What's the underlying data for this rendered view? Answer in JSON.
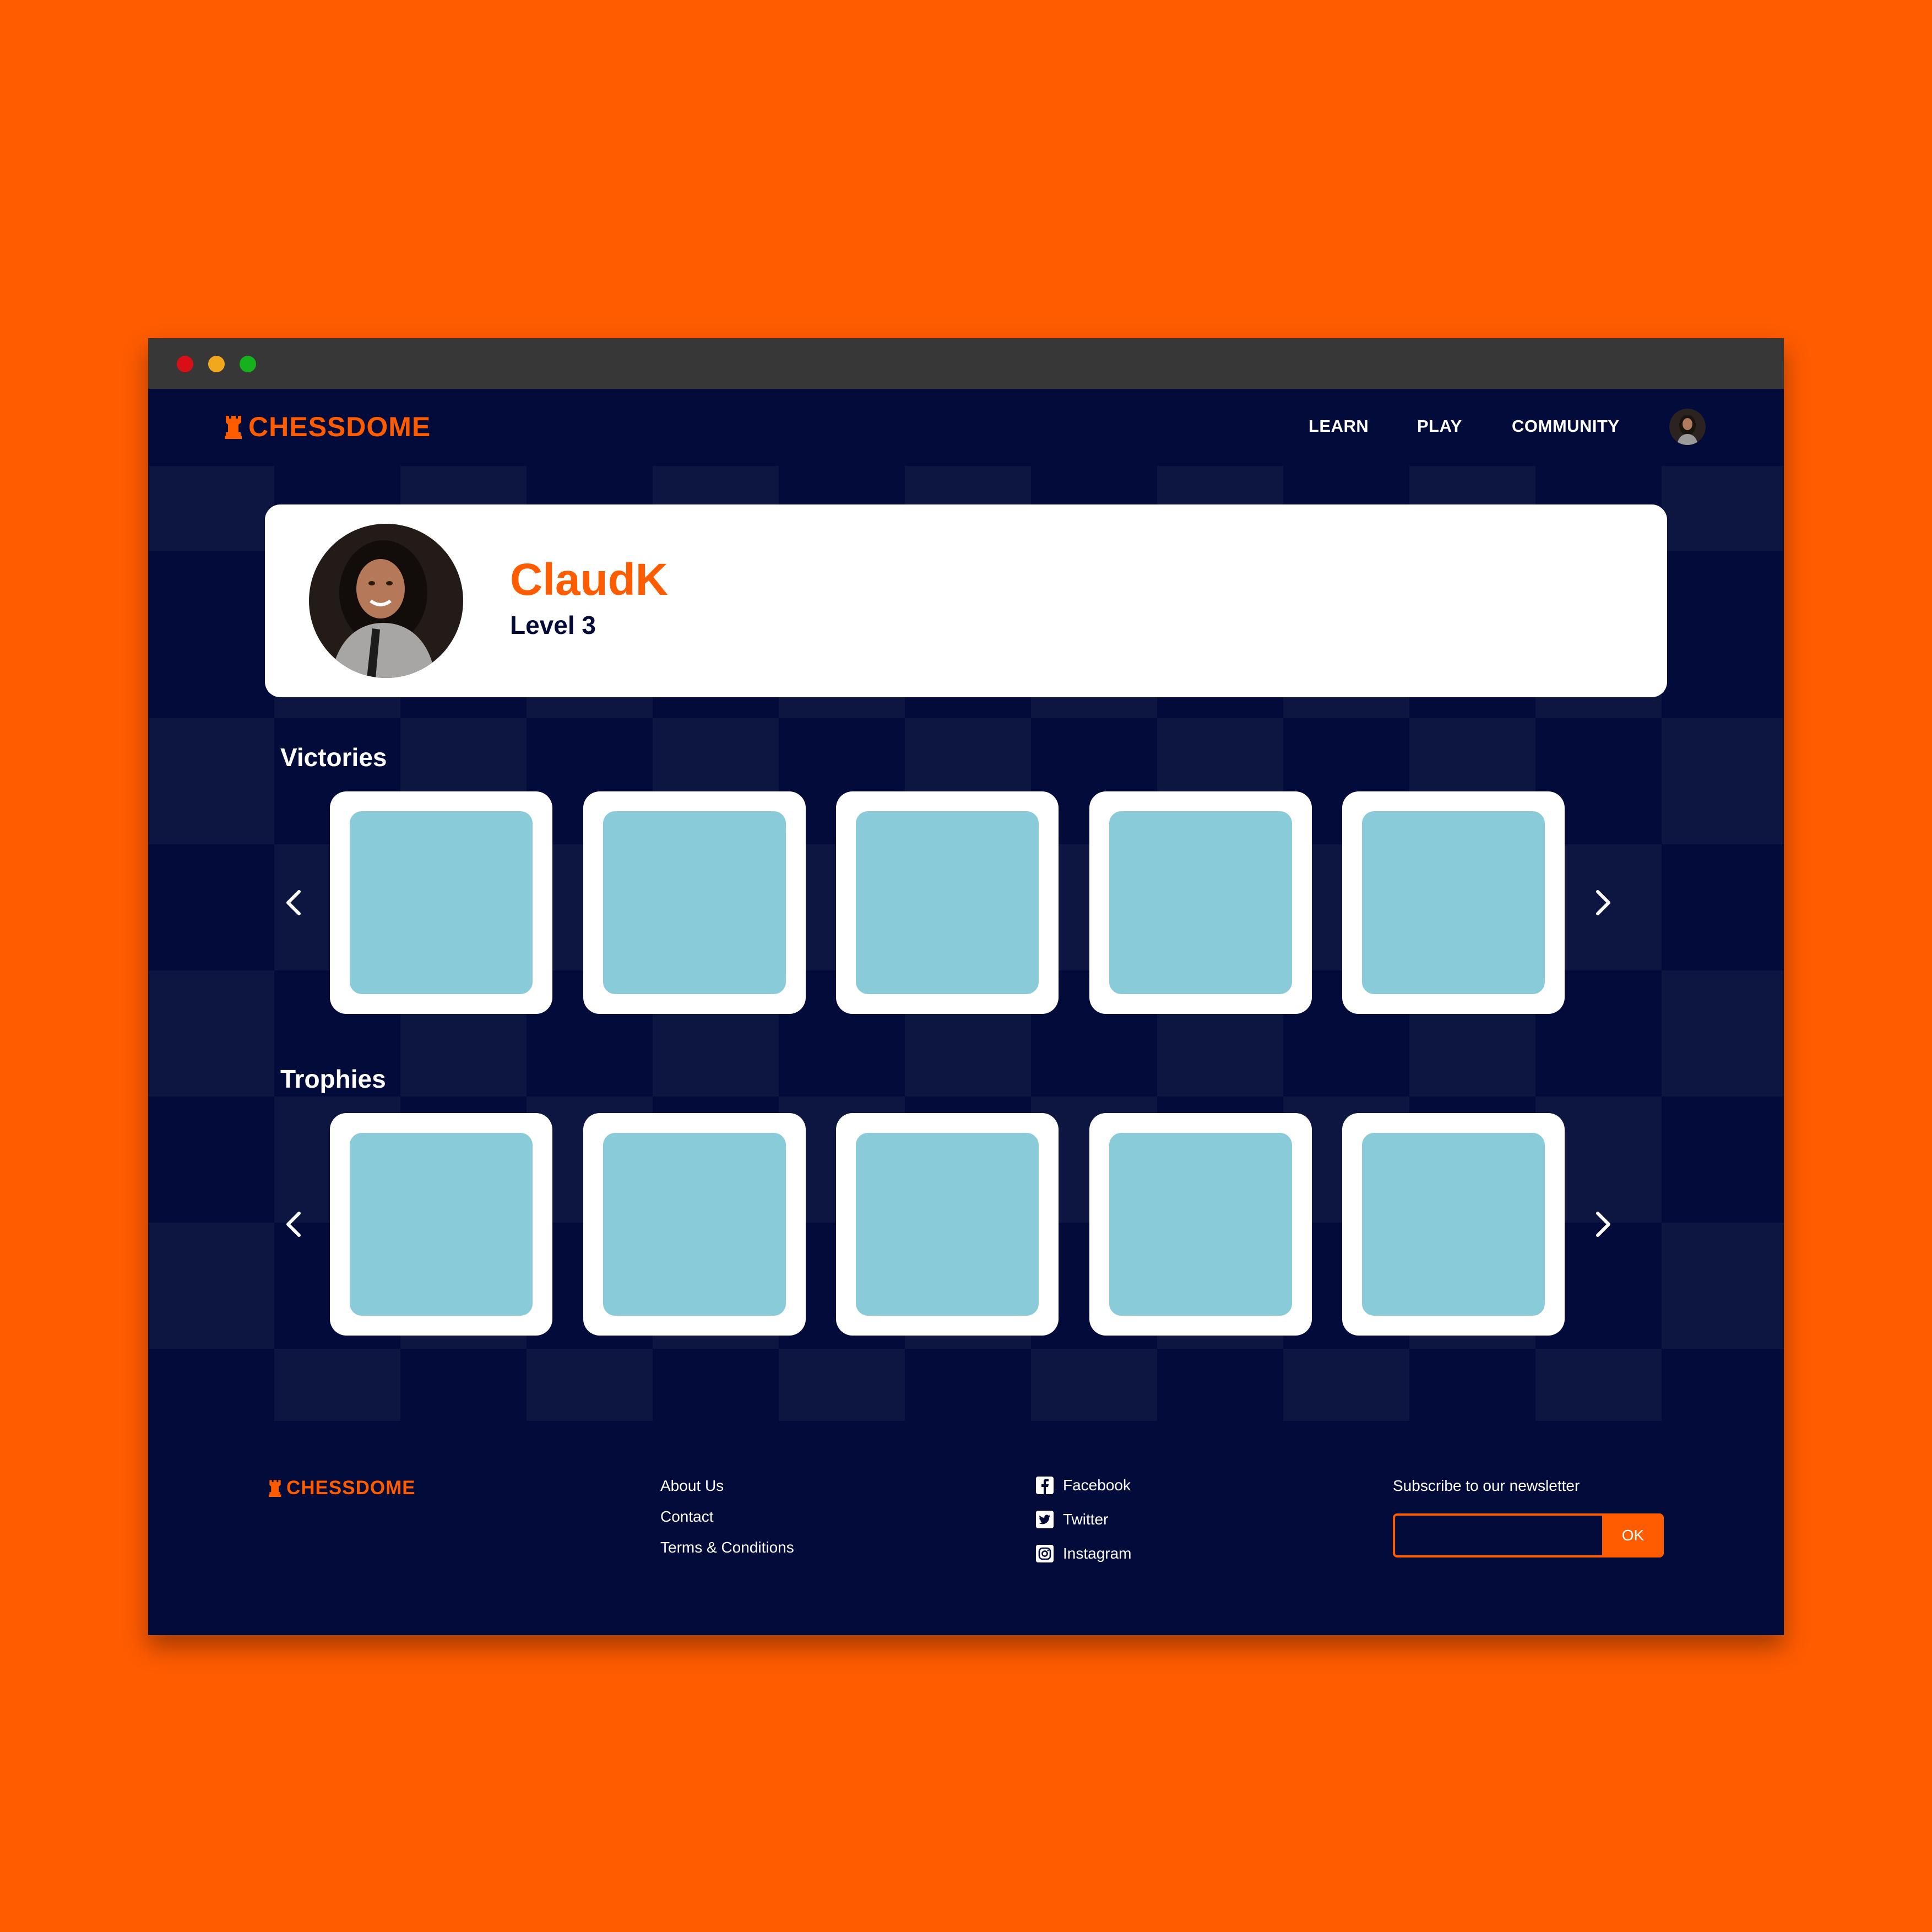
{
  "window": {
    "controls": [
      "close",
      "minimize",
      "maximize"
    ]
  },
  "brand": {
    "name": "CHESSDOME",
    "logo_icon": "rook-icon",
    "accent_color": "#FF5C00",
    "background_color": "#020B3A"
  },
  "nav": {
    "links": [
      "LEARN",
      "PLAY",
      "COMMUNITY"
    ],
    "avatar_icon": "user-avatar"
  },
  "profile": {
    "username": "ClaudK",
    "level": "Level 3"
  },
  "sections": {
    "victories": {
      "title": "Victories",
      "tile_count": 5
    },
    "trophies": {
      "title": "Trophies",
      "tile_count": 5
    },
    "tile_colors": {
      "frame": "#FFFFFF",
      "inner": "#89CBD8"
    }
  },
  "footer": {
    "brand": "CHESSDOME",
    "links": [
      "About Us",
      "Contact",
      "Terms & Conditions"
    ],
    "social": [
      {
        "label": "Facebook",
        "icon": "facebook-icon"
      },
      {
        "label": "Twitter",
        "icon": "twitter-icon"
      },
      {
        "label": "Instagram",
        "icon": "instagram-icon"
      }
    ],
    "newsletter": {
      "label": "Subscribe to our newsletter",
      "input_value": "",
      "button": "OK"
    }
  }
}
